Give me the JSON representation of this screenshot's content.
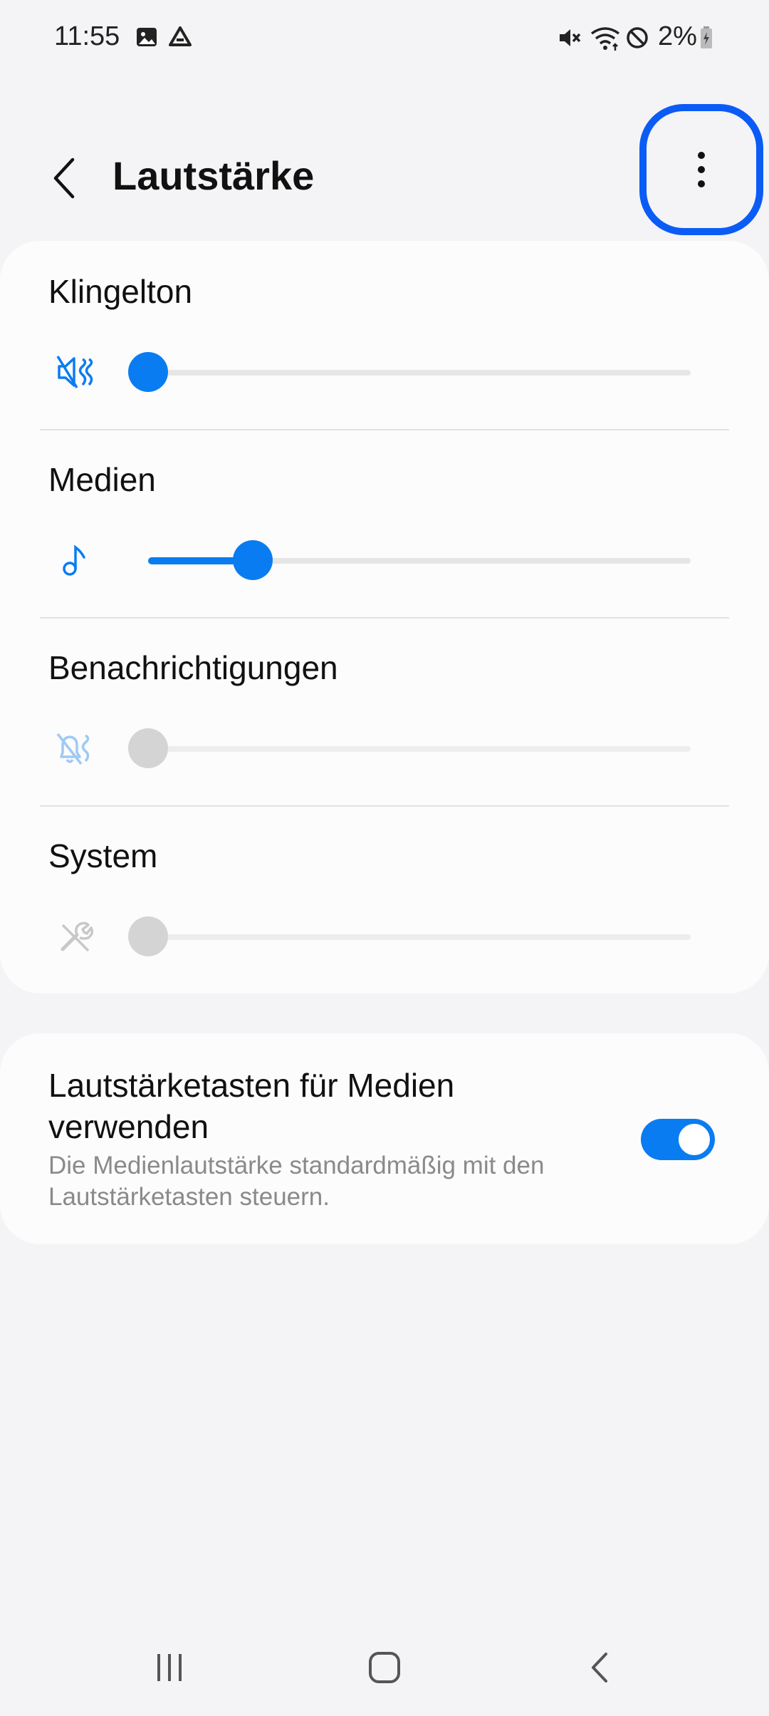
{
  "status_bar": {
    "time": "11:55",
    "battery": "2%",
    "icons": [
      "image-icon",
      "drive-icon",
      "mute-icon",
      "wifi-icon",
      "do-not-disturb-icon",
      "battery-charging-icon"
    ]
  },
  "header": {
    "title": "Lautstärke",
    "back_icon": "chevron-left-icon",
    "more_icon": "more-vert-icon"
  },
  "volumes": [
    {
      "label": "Klingelton",
      "icon": "ringtone-muted-icon",
      "level": 0.0,
      "enabled": true
    },
    {
      "label": "Medien",
      "icon": "music-note-icon",
      "level": 0.2,
      "enabled": true
    },
    {
      "label": "Benachrichtigungen",
      "icon": "notification-muted-icon",
      "level": 0.0,
      "enabled": false
    },
    {
      "label": "System",
      "icon": "tools-muted-icon",
      "level": 0.0,
      "enabled": false
    }
  ],
  "media_keys": {
    "title": "Lautstärketasten für Medien verwenden",
    "description": "Die Medienlautstärke standardmäßig mit den Lautstärketasten steuern.",
    "enabled": true
  },
  "colors": {
    "accent": "#0a7cf2",
    "highlight": "#0b5cf5",
    "disabled": "#d4d4d4",
    "background": "#f4f4f6"
  },
  "nav_bar": {
    "icons": [
      "recent-apps-icon",
      "home-icon",
      "back-icon"
    ]
  }
}
